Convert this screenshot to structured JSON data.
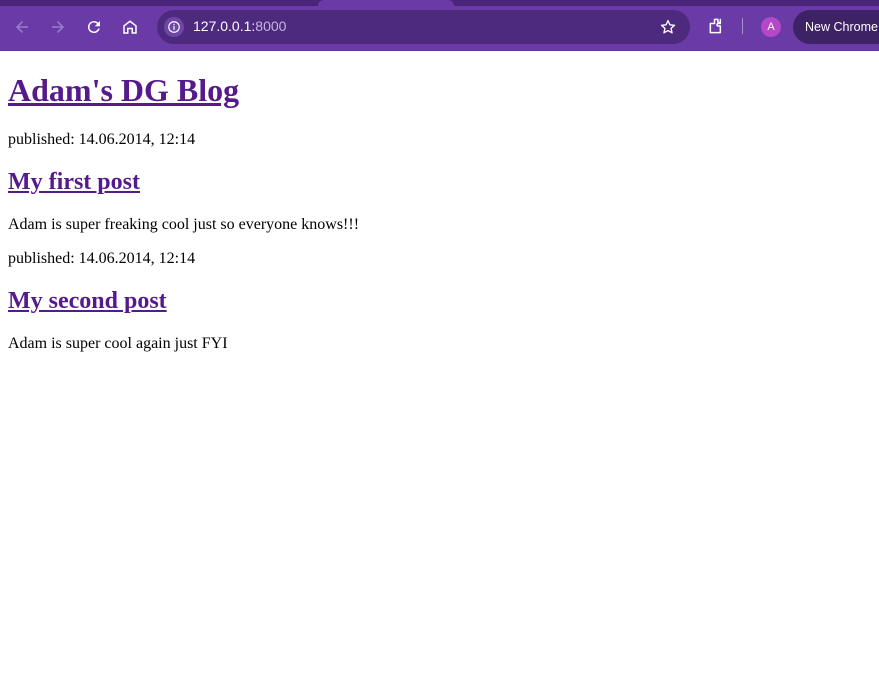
{
  "browser": {
    "url_host": "127.0.0.1:",
    "url_port": "8000",
    "profile_initial": "A",
    "new_chrome_label": "New Chrome a",
    "colors": {
      "toolbar": "#6a3aa6",
      "omnibox": "#4d2a7e",
      "avatar": "#b548c6"
    }
  },
  "blog": {
    "title": "Adam's DG Blog",
    "posts": [
      {
        "published": "published: 14.06.2014, 12:14",
        "title": "My first post",
        "text": "Adam is super freaking cool just so everyone knows!!!"
      },
      {
        "published": "published: 14.06.2014, 12:14",
        "title": "My second post",
        "text": "Adam is super cool again just FYI"
      }
    ],
    "link_color": "#551a8b"
  },
  "icons": [
    "back-arrow-icon",
    "forward-arrow-icon",
    "reload-icon",
    "home-icon",
    "site-info-icon",
    "bookmark-star-icon",
    "extensions-icon"
  ]
}
